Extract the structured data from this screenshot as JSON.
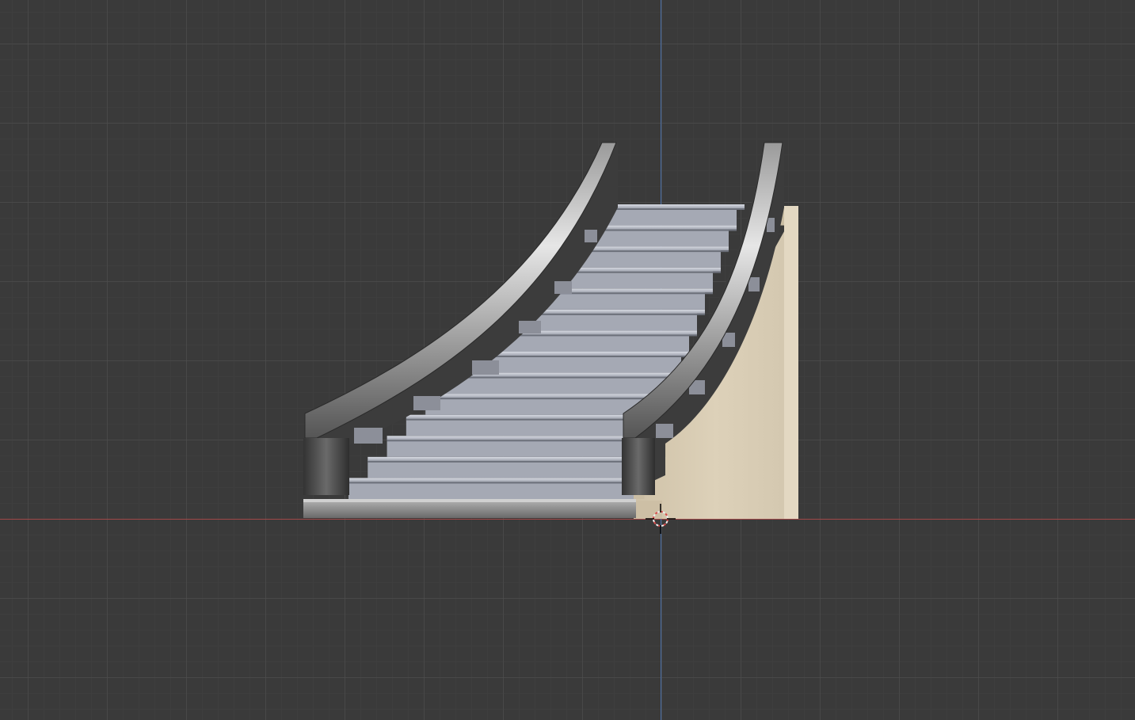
{
  "viewport": {
    "background_color": "#3a3a3a",
    "grid_color": "#505050",
    "x_axis_color": "#a04848",
    "y_axis_color": "#4a6fa8"
  },
  "scene": {
    "object": "staircase-with-railings",
    "step_count": 14,
    "materials": {
      "steps": "#a9acb6",
      "railing": "#4a4a4a",
      "stringer": "#d8ccb4"
    }
  },
  "cursor": {
    "icon": "3d-cursor-icon"
  }
}
